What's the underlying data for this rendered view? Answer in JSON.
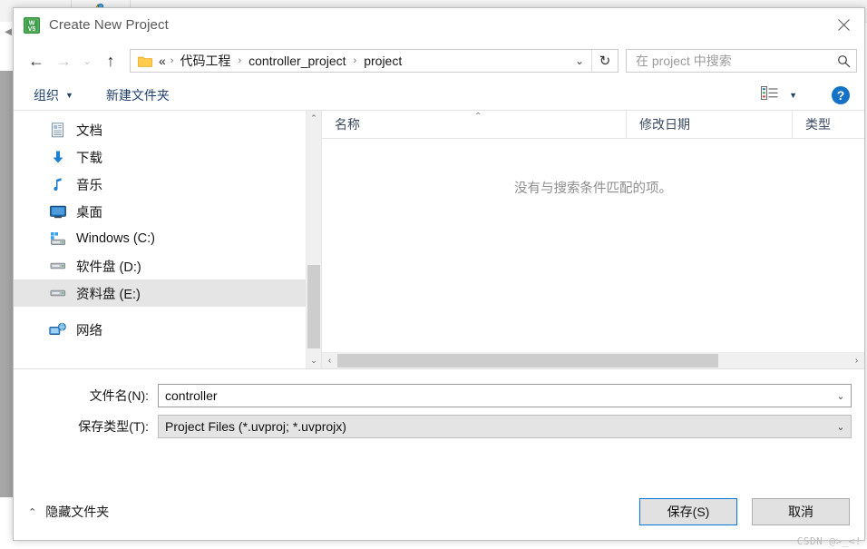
{
  "dialog": {
    "title": "Create New Project",
    "app_icon": "uvision-icon",
    "close_label": "✕"
  },
  "nav": {
    "back": "←",
    "forward": "→",
    "recent": "⌄",
    "up": "↑",
    "breadcrumb": {
      "folder_icon": "folder-icon",
      "overflow": "«",
      "items": [
        "代码工程",
        "controller_project",
        "project"
      ],
      "separator": "›",
      "dropdown": "⌄",
      "refresh": "↻"
    },
    "search": {
      "placeholder": "在 project 中搜索",
      "icon": "search-icon"
    }
  },
  "command_bar": {
    "organize": "组织",
    "organize_caret": "▼",
    "new_folder": "新建文件夹",
    "view_icon": "list-view-icon",
    "view_caret": "▼",
    "help": "?"
  },
  "sidebar": {
    "items": [
      {
        "label": "文档",
        "icon": "documents-icon",
        "selected": false
      },
      {
        "label": "下载",
        "icon": "downloads-icon",
        "selected": false
      },
      {
        "label": "音乐",
        "icon": "music-icon",
        "selected": false
      },
      {
        "label": "桌面",
        "icon": "desktop-icon",
        "selected": false
      },
      {
        "label": "Windows (C:)",
        "icon": "system-drive-icon",
        "selected": false
      },
      {
        "label": "软件盘 (D:)",
        "icon": "drive-icon",
        "selected": false
      },
      {
        "label": "资料盘 (E:)",
        "icon": "drive-icon",
        "selected": true
      }
    ],
    "network": {
      "label": "网络",
      "icon": "network-icon"
    }
  },
  "filelist": {
    "columns": [
      {
        "label": "名称",
        "sorted": "asc",
        "sort_caret": "⌃"
      },
      {
        "label": "修改日期",
        "sorted": "none"
      },
      {
        "label": "类型",
        "sorted": "none"
      }
    ],
    "empty_message": "没有与搜索条件匹配的项。",
    "rows": []
  },
  "form": {
    "filename": {
      "label": "文件名(N):",
      "value": "controller",
      "caret": "⌄"
    },
    "filetype": {
      "label": "保存类型(T):",
      "value": "Project Files (*.uvproj; *.uvprojx)",
      "caret": "⌄"
    }
  },
  "footer": {
    "hide_folders": "隐藏文件夹",
    "hide_folders_caret": "⌃",
    "save": "保存(S)",
    "cancel": "取消"
  },
  "watermark": "CSDN @>_<!",
  "scrollbars": {
    "tree_up": "⌃",
    "tree_down": "⌄",
    "list_left": "‹",
    "list_right": "›"
  },
  "colors": {
    "accent": "#0078d7",
    "link": "#22426b",
    "selection": "#e5e5e5",
    "help_blue": "#1473c6"
  }
}
